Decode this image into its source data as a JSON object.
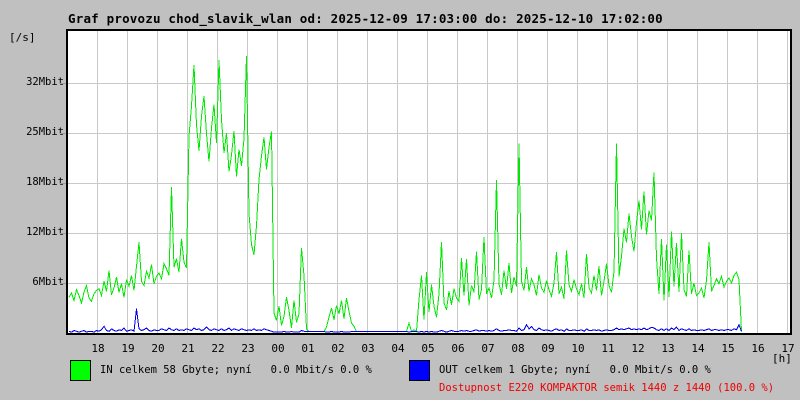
{
  "title": "Graf provozu chod_slavik_wlan od: 2025-12-09 17:03:00 do: 2025-12-10 17:02:00",
  "y_unit_label": "[/s]",
  "x_unit_label": "[h]",
  "colors": {
    "page_background": "#c0c0c0",
    "plot_background": "#ffffff",
    "plot_border": "#000000",
    "grid": "#c9c9c9",
    "in_line": "#00e800",
    "out_line": "#0000e8",
    "in_swatch": "#00ff00",
    "out_swatch": "#0000ff",
    "availability_text": "#ee0000",
    "text": "#000000"
  },
  "legend": {
    "in_label": "IN celkem 58 Gbyte; nyní   0.0 Mbit/s 0.0 %",
    "out_label": "OUT celkem 1 Gbyte; nyní   0.0 Mbit/s 0.0 %",
    "availability": "Dostupnost E220 KOMPAKTOR semik 1440 z 1440 (100.0 %)"
  },
  "chart_data": {
    "type": "line",
    "title": "Graf provozu chod_slavik_wlan od: 2025-12-09 17:03:00 do: 2025-12-10 17:02:00",
    "xlabel": "[h]",
    "ylabel": "[/s]",
    "grid": true,
    "legend_position": "bottom",
    "time_start": "2025-12-09 17:03:00",
    "time_end": "2025-12-10 17:02:00",
    "data_ends_at": "2025-12-10 15:25",
    "sample_interval_minutes": 5,
    "x_ticks": [
      "18",
      "19",
      "20",
      "21",
      "22",
      "23",
      "00",
      "01",
      "02",
      "03",
      "04",
      "05",
      "06",
      "07",
      "08",
      "09",
      "10",
      "11",
      "12",
      "13",
      "14",
      "15",
      "16",
      "17"
    ],
    "y_ticks": [
      {
        "label": "32Mbit",
        "value": 32
      },
      {
        "label": "25Mbit",
        "value": 25
      },
      {
        "label": "18Mbit",
        "value": 18
      },
      {
        "label": "12Mbit",
        "value": 12
      },
      {
        "label": "6Mbit",
        "value": 6
      }
    ],
    "ylim": [
      0,
      36.2
    ],
    "y_axis_anchors": [
      [
        0,
        0
      ],
      [
        6,
        50
      ],
      [
        12,
        100
      ],
      [
        18,
        150
      ],
      [
        25,
        200
      ],
      [
        32,
        250
      ]
    ],
    "series": [
      {
        "name": "IN",
        "unit": "Mbit/s",
        "total": "58 Gbyte",
        "now": "0.0 Mbit/s",
        "percent_now": "0.0 %",
        "values": [
          4.3,
          4.8,
          3.9,
          5.2,
          4.5,
          3.6,
          4.9,
          5.7,
          4.2,
          3.8,
          4.7,
          5.1,
          5.3,
          4.5,
          6.2,
          5.0,
          7.5,
          4.6,
          5.4,
          6.7,
          4.9,
          5.9,
          4.3,
          6.4,
          5.6,
          6.9,
          5.1,
          8.0,
          10.9,
          6.2,
          5.7,
          7.4,
          6.6,
          8.2,
          5.9,
          6.8,
          7.2,
          6.5,
          8.3,
          7.7,
          6.9,
          17.5,
          7.9,
          8.9,
          7.3,
          11.3,
          8.5,
          7.8,
          24.6,
          28.8,
          34.5,
          26.1,
          22.5,
          27.4,
          30.2,
          24.9,
          21.0,
          25.7,
          29.0,
          23.6,
          35.2,
          26.9,
          22.2,
          25.0,
          19.6,
          21.9,
          25.3,
          18.9,
          22.7,
          20.4,
          24.2,
          35.8,
          14.3,
          10.6,
          9.4,
          12.9,
          18.5,
          21.8,
          24.4,
          19.9,
          23.0,
          25.2,
          2.4,
          1.5,
          3.2,
          0.9,
          2.0,
          4.3,
          2.7,
          0.6,
          3.9,
          1.3,
          2.3,
          10.2,
          6.9,
          0.5,
          0,
          0,
          0,
          0,
          0,
          0,
          0,
          0.7,
          1.9,
          3.0,
          1.6,
          3.3,
          2.3,
          3.9,
          1.7,
          4.2,
          2.6,
          1.2,
          0.8,
          0,
          0,
          0,
          0,
          0,
          0,
          0,
          0,
          0,
          0,
          0,
          0,
          0,
          0,
          0,
          0,
          0,
          0,
          0,
          0,
          0,
          1.2,
          0,
          0.4,
          0,
          4.0,
          6.9,
          1.6,
          7.3,
          2.5,
          5.8,
          3.2,
          1.9,
          4.7,
          10.9,
          3.6,
          2.8,
          5.0,
          3.4,
          5.3,
          4.2,
          3.8,
          9.0,
          4.5,
          8.9,
          3.3,
          5.7,
          4.9,
          9.8,
          4.0,
          5.2,
          11.5,
          4.7,
          5.4,
          4.2,
          6.3,
          18.4,
          5.9,
          4.6,
          7.5,
          5.3,
          8.4,
          4.8,
          6.7,
          5.6,
          23.5,
          6.2,
          5.1,
          7.9,
          5.0,
          6.5,
          5.8,
          4.5,
          7.0,
          5.4,
          4.9,
          6.3,
          5.2,
          4.4,
          6.0,
          9.7,
          4.7,
          5.5,
          4.1,
          9.9,
          5.8,
          5.0,
          6.4,
          5.3,
          4.6,
          5.9,
          4.2,
          9.5,
          5.4,
          4.8,
          6.9,
          5.1,
          8.0,
          4.5,
          6.2,
          8.3,
          5.7,
          4.9,
          7.4,
          23.5,
          6.8,
          9.2,
          12.5,
          10.9,
          14.3,
          11.6,
          9.8,
          13.2,
          15.9,
          12.4,
          17.0,
          11.8,
          14.7,
          13.5,
          19.5,
          9.0,
          4.7,
          11.3,
          3.9,
          10.6,
          4.3,
          12.2,
          5.6,
          10.8,
          4.9,
          12.0,
          5.2,
          4.4,
          9.9,
          4.7,
          6.0,
          4.5,
          4.8,
          5.4,
          4.2,
          6.3,
          10.9,
          5.0,
          5.7,
          6.5,
          5.9,
          6.8,
          5.5,
          6.2,
          6.6,
          6.0,
          6.9,
          7.3,
          6.4,
          0
        ]
      },
      {
        "name": "OUT",
        "unit": "Mbit/s",
        "total": "1 Gbyte",
        "now": "0.0 Mbit/s",
        "percent_now": "0.0 %",
        "values": [
          0.2,
          0.1,
          0.3,
          0.2,
          0.1,
          0.2,
          0.3,
          0.1,
          0.2,
          0.2,
          0.1,
          0.3,
          0.2,
          0.4,
          0.8,
          0.3,
          0.2,
          0.5,
          0.3,
          0.2,
          0.4,
          0.3,
          0.6,
          0.2,
          0.3,
          0.4,
          0.2,
          2.9,
          0.5,
          0.3,
          0.4,
          0.6,
          0.3,
          0.2,
          0.4,
          0.3,
          0.3,
          0.5,
          0.4,
          0.3,
          0.6,
          0.4,
          0.3,
          0.5,
          0.3,
          0.4,
          0.3,
          0.5,
          0.4,
          0.3,
          0.6,
          0.4,
          0.5,
          0.3,
          0.4,
          0.7,
          0.4,
          0.3,
          0.5,
          0.4,
          0.3,
          0.5,
          0.3,
          0.4,
          0.6,
          0.3,
          0.5,
          0.4,
          0.3,
          0.5,
          0.4,
          0.3,
          0.4,
          0.3,
          0.5,
          0.3,
          0.4,
          0.3,
          0.5,
          0.4,
          0.3,
          0.2,
          0.1,
          0.1,
          0.1,
          0.1,
          0.2,
          0.1,
          0.1,
          0,
          0.1,
          0.1,
          0.1,
          0.3,
          0.2,
          0,
          0,
          0,
          0,
          0,
          0,
          0,
          0,
          0.1,
          0.1,
          0.2,
          0.1,
          0.1,
          0.1,
          0.2,
          0.1,
          0.1,
          0.1,
          0,
          0,
          0,
          0,
          0,
          0,
          0,
          0,
          0,
          0,
          0,
          0,
          0,
          0,
          0,
          0,
          0,
          0,
          0,
          0,
          0,
          0,
          0,
          0.1,
          0,
          0,
          0,
          0.1,
          0.2,
          0.1,
          0.2,
          0.1,
          0.2,
          0.1,
          0.1,
          0.2,
          0.3,
          0.2,
          0.1,
          0.2,
          0.3,
          0.2,
          0.2,
          0.2,
          0.3,
          0.2,
          0.3,
          0.2,
          0.2,
          0.3,
          0.4,
          0.2,
          0.3,
          0.3,
          0.2,
          0.3,
          0.2,
          0.3,
          0.5,
          0.3,
          0.2,
          0.3,
          0.3,
          0.4,
          0.3,
          0.3,
          0.2,
          0.6,
          0.3,
          0.4,
          1.0,
          0.5,
          0.8,
          0.4,
          0.3,
          0.6,
          0.4,
          0.3,
          0.4,
          0.3,
          0.2,
          0.4,
          0.5,
          0.3,
          0.4,
          0.2,
          0.5,
          0.3,
          0.3,
          0.4,
          0.3,
          0.3,
          0.4,
          0.2,
          0.5,
          0.3,
          0.3,
          0.4,
          0.3,
          0.4,
          0.2,
          0.3,
          0.4,
          0.3,
          0.3,
          0.4,
          0.6,
          0.4,
          0.5,
          0.4,
          0.5,
          0.6,
          0.4,
          0.5,
          0.4,
          0.5,
          0.4,
          0.6,
          0.4,
          0.5,
          0.7,
          0.6,
          0.4,
          0.3,
          0.5,
          0.3,
          0.5,
          0.3,
          0.6,
          0.4,
          0.7,
          0.3,
          0.5,
          0.4,
          0.3,
          0.5,
          0.3,
          0.4,
          0.3,
          0.3,
          0.4,
          0.3,
          0.4,
          0.5,
          0.3,
          0.4,
          0.4,
          0.3,
          0.4,
          0.3,
          0.4,
          0.4,
          0.3,
          0.5,
          0.4,
          1.0,
          0
        ]
      }
    ]
  }
}
